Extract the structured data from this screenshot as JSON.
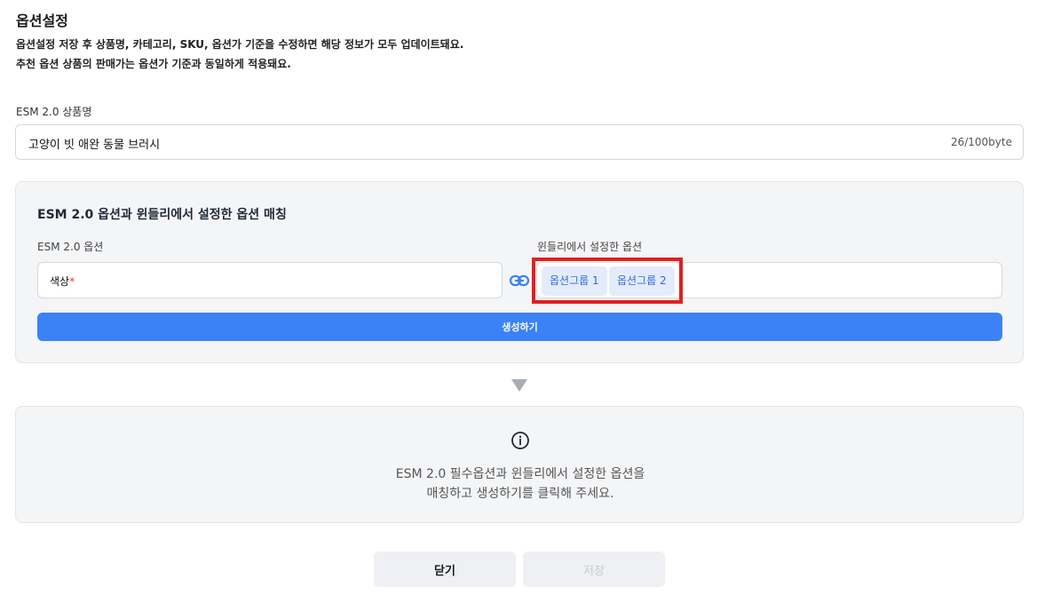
{
  "header": {
    "title": "옵션설정",
    "desc_line1": "옵션설정 저장 후 상품명, 카테고리, SKU, 옵션가 기준을 수정하면 해당 정보가 모두 업데이트돼요.",
    "desc_line2": "추천 옵션 상품의 판매가는 옵션가 기준과 동일하게 적용돼요."
  },
  "product_name": {
    "label": "ESM 2.0 상품명",
    "value": "고양이 빗 애완 동물 브러시",
    "byte_count": "26/100byte"
  },
  "matching": {
    "title": "ESM 2.0 옵션과 윈들리에서 설정한 옵션 매칭",
    "esm_label": "ESM 2.0 옵션",
    "esm_option": "색상",
    "required_mark": "*",
    "windly_label": "윈들리에서 설정한 옵션",
    "windly_chips": [
      "옵션그룹 1",
      "옵션그룹 2"
    ],
    "generate_label": "생성하기"
  },
  "info": {
    "line1": "ESM 2.0 필수옵션과 윈들리에서 설정한 옵션을",
    "line2": "매칭하고 생성하기를 클릭해 주세요."
  },
  "footer": {
    "close_label": "닫기",
    "save_label": "저장"
  },
  "colors": {
    "accent": "#3a82f6",
    "chip_bg": "#e4ecfb",
    "chip_text": "#2e6de0",
    "highlight": "#e02020",
    "required": "#e53935"
  }
}
